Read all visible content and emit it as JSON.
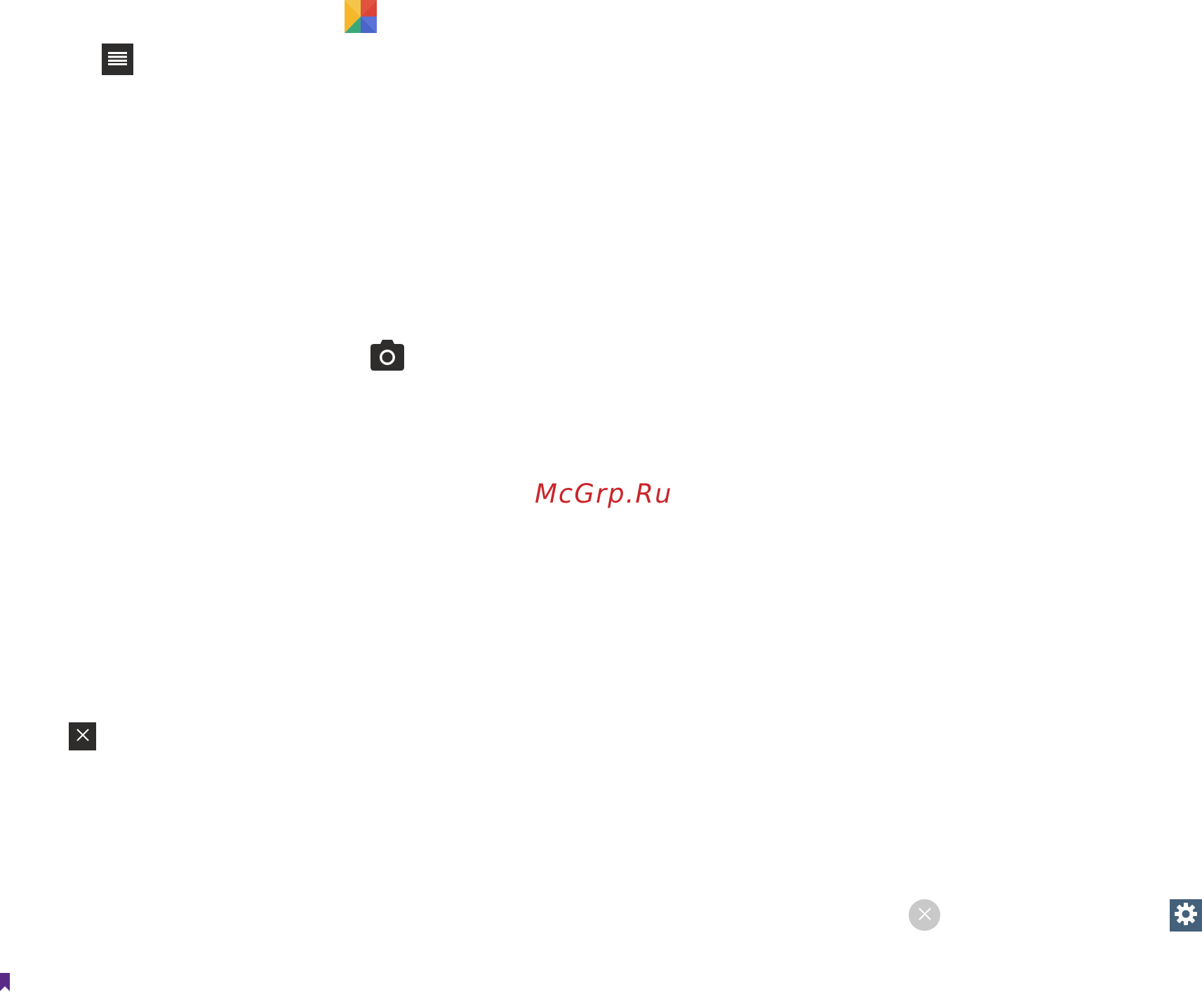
{
  "watermark": {
    "text": "McGrp.Ru",
    "color": "#c9252a"
  },
  "icons": {
    "app_logo": "google-photos-pinwheel-icon",
    "menu": "hamburger-menu-icon",
    "camera": "camera-icon",
    "close_square": "close-icon",
    "close_circle": "close-circle-icon",
    "settings": "gear-icon",
    "bookmark": "bookmark-icon"
  },
  "colors": {
    "dark_button": "#2f2d2c",
    "settings_button": "#44607a",
    "close_circle": "#c9c9c9",
    "bookmark": "#5b2a86",
    "logo_yellow": "#f6b82a",
    "logo_red": "#db4437",
    "logo_blue": "#5a73d6",
    "logo_green": "#3aa87a"
  }
}
